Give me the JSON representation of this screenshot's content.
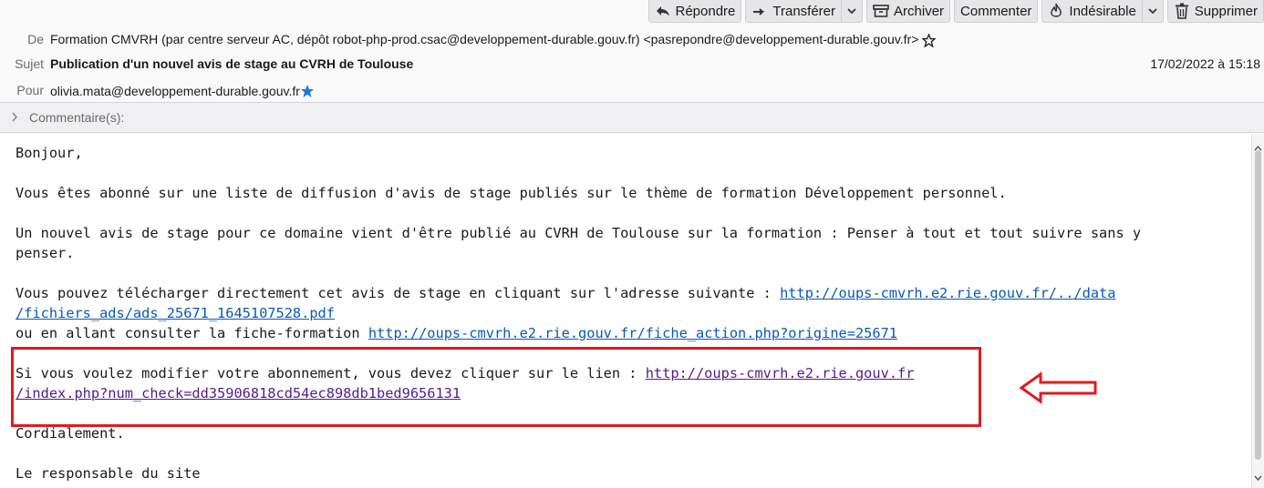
{
  "toolbar": {
    "reply": "Répondre",
    "forward": "Transférer",
    "archive": "Archiver",
    "comment": "Commenter",
    "junk": "Indésirable",
    "delete": "Supprimer"
  },
  "header": {
    "from_label": "De",
    "from_value": "Formation CMVRH (par centre serveur AC, dépôt robot-php-prod.csac@developpement-durable.gouv.fr) <pasrepondre@developpement-durable.gouv.fr>",
    "subject_label": "Sujet",
    "subject_value": "Publication d'un nouvel avis de stage au CVRH de Toulouse",
    "date_value": "17/02/2022 à 15:18",
    "to_label": "Pour",
    "to_value": "olivia.mata@developpement-durable.gouv.fr"
  },
  "comments": {
    "label": "Commentaire(s):"
  },
  "message": {
    "greeting": "Bonjour,",
    "line1": "Vous êtes abonné sur une liste de diffusion d'avis de stage publiés sur le thème de formation Développement personnel.",
    "line2a": "Un nouvel avis de stage pour ce domaine vient d'être publié au CVRH de Toulouse sur la formation : Penser à tout et tout suivre sans y",
    "line2b": "penser.",
    "line3_text": "Vous pouvez télécharger directement cet avis de stage en cliquant sur l'adresse suivante : ",
    "link1a": "http://oups-cmvrh.e2.rie.gouv.fr/../data",
    "link1b": "/fichiers_ads/ads_25671_1645107528.pdf",
    "line4_text": "ou en allant consulter la fiche-formation ",
    "link2": "http://oups-cmvrh.e2.rie.gouv.fr/fiche_action.php?origine=25671",
    "line5_text": "Si vous voulez modifier votre abonnement, vous devez cliquer sur le lien : ",
    "link3a": "http://oups-cmvrh.e2.rie.gouv.fr",
    "link3b": "/index.php?num_check=dd35906818cd54ec898db1bed9656131",
    "closing": "Cordialement.",
    "signature": "Le responsable du site"
  },
  "colors": {
    "link": "#0a59b3",
    "visited_link": "#551a8b",
    "annotation": "#e01a22",
    "star": "#1a7ae0"
  }
}
